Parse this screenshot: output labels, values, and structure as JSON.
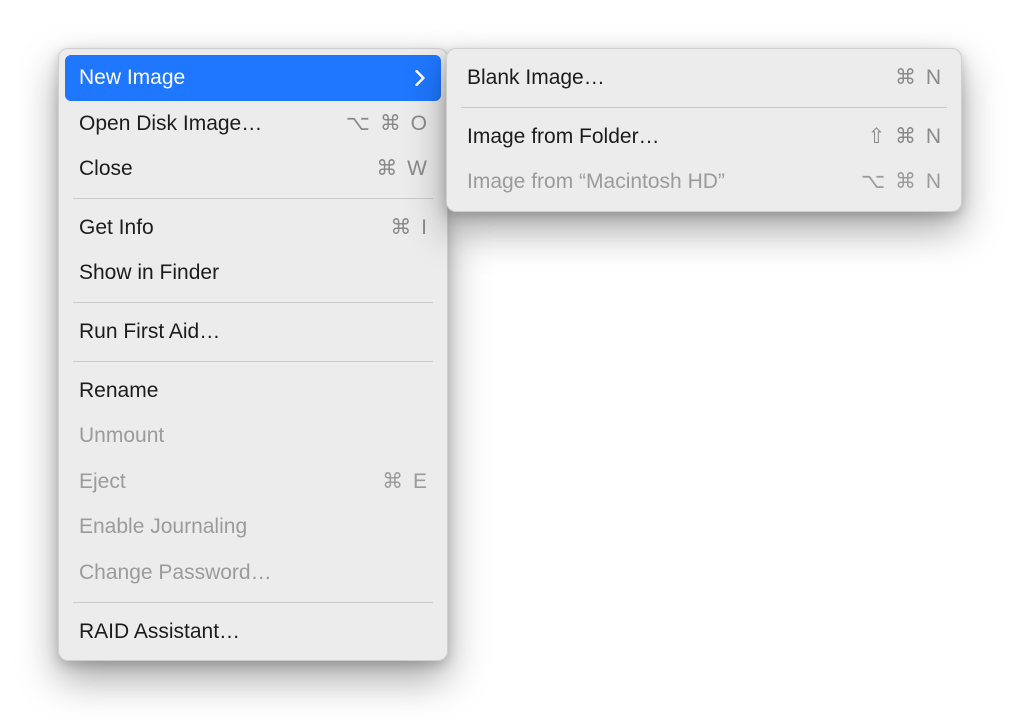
{
  "mainMenu": {
    "items": [
      {
        "label": "New Image",
        "shortcut": "",
        "hasSubmenu": true,
        "disabled": false,
        "highlighted": true
      },
      {
        "label": "Open Disk Image…",
        "shortcut": "⌥ ⌘ O",
        "hasSubmenu": false,
        "disabled": false,
        "highlighted": false
      },
      {
        "label": "Close",
        "shortcut": "⌘ W",
        "hasSubmenu": false,
        "disabled": false,
        "highlighted": false
      },
      {
        "separator": true
      },
      {
        "label": "Get Info",
        "shortcut": "⌘ I",
        "hasSubmenu": false,
        "disabled": false,
        "highlighted": false
      },
      {
        "label": "Show in Finder",
        "shortcut": "",
        "hasSubmenu": false,
        "disabled": false,
        "highlighted": false
      },
      {
        "separator": true
      },
      {
        "label": "Run First Aid…",
        "shortcut": "",
        "hasSubmenu": false,
        "disabled": false,
        "highlighted": false
      },
      {
        "separator": true
      },
      {
        "label": "Rename",
        "shortcut": "",
        "hasSubmenu": false,
        "disabled": false,
        "highlighted": false
      },
      {
        "label": "Unmount",
        "shortcut": "",
        "hasSubmenu": false,
        "disabled": true,
        "highlighted": false
      },
      {
        "label": "Eject",
        "shortcut": "⌘ E",
        "hasSubmenu": false,
        "disabled": true,
        "highlighted": false
      },
      {
        "label": "Enable Journaling",
        "shortcut": "",
        "hasSubmenu": false,
        "disabled": true,
        "highlighted": false
      },
      {
        "label": "Change Password…",
        "shortcut": "",
        "hasSubmenu": false,
        "disabled": true,
        "highlighted": false
      },
      {
        "separator": true
      },
      {
        "label": "RAID Assistant…",
        "shortcut": "",
        "hasSubmenu": false,
        "disabled": false,
        "highlighted": false
      }
    ]
  },
  "subMenu": {
    "items": [
      {
        "label": "Blank Image…",
        "shortcut": "⌘ N",
        "hasSubmenu": false,
        "disabled": false,
        "highlighted": false
      },
      {
        "separator": true
      },
      {
        "label": "Image from Folder…",
        "shortcut": "⇧ ⌘ N",
        "hasSubmenu": false,
        "disabled": false,
        "highlighted": false
      },
      {
        "label": "Image from “Macintosh HD”",
        "shortcut": "⌥ ⌘ N",
        "hasSubmenu": false,
        "disabled": true,
        "highlighted": false
      }
    ]
  }
}
